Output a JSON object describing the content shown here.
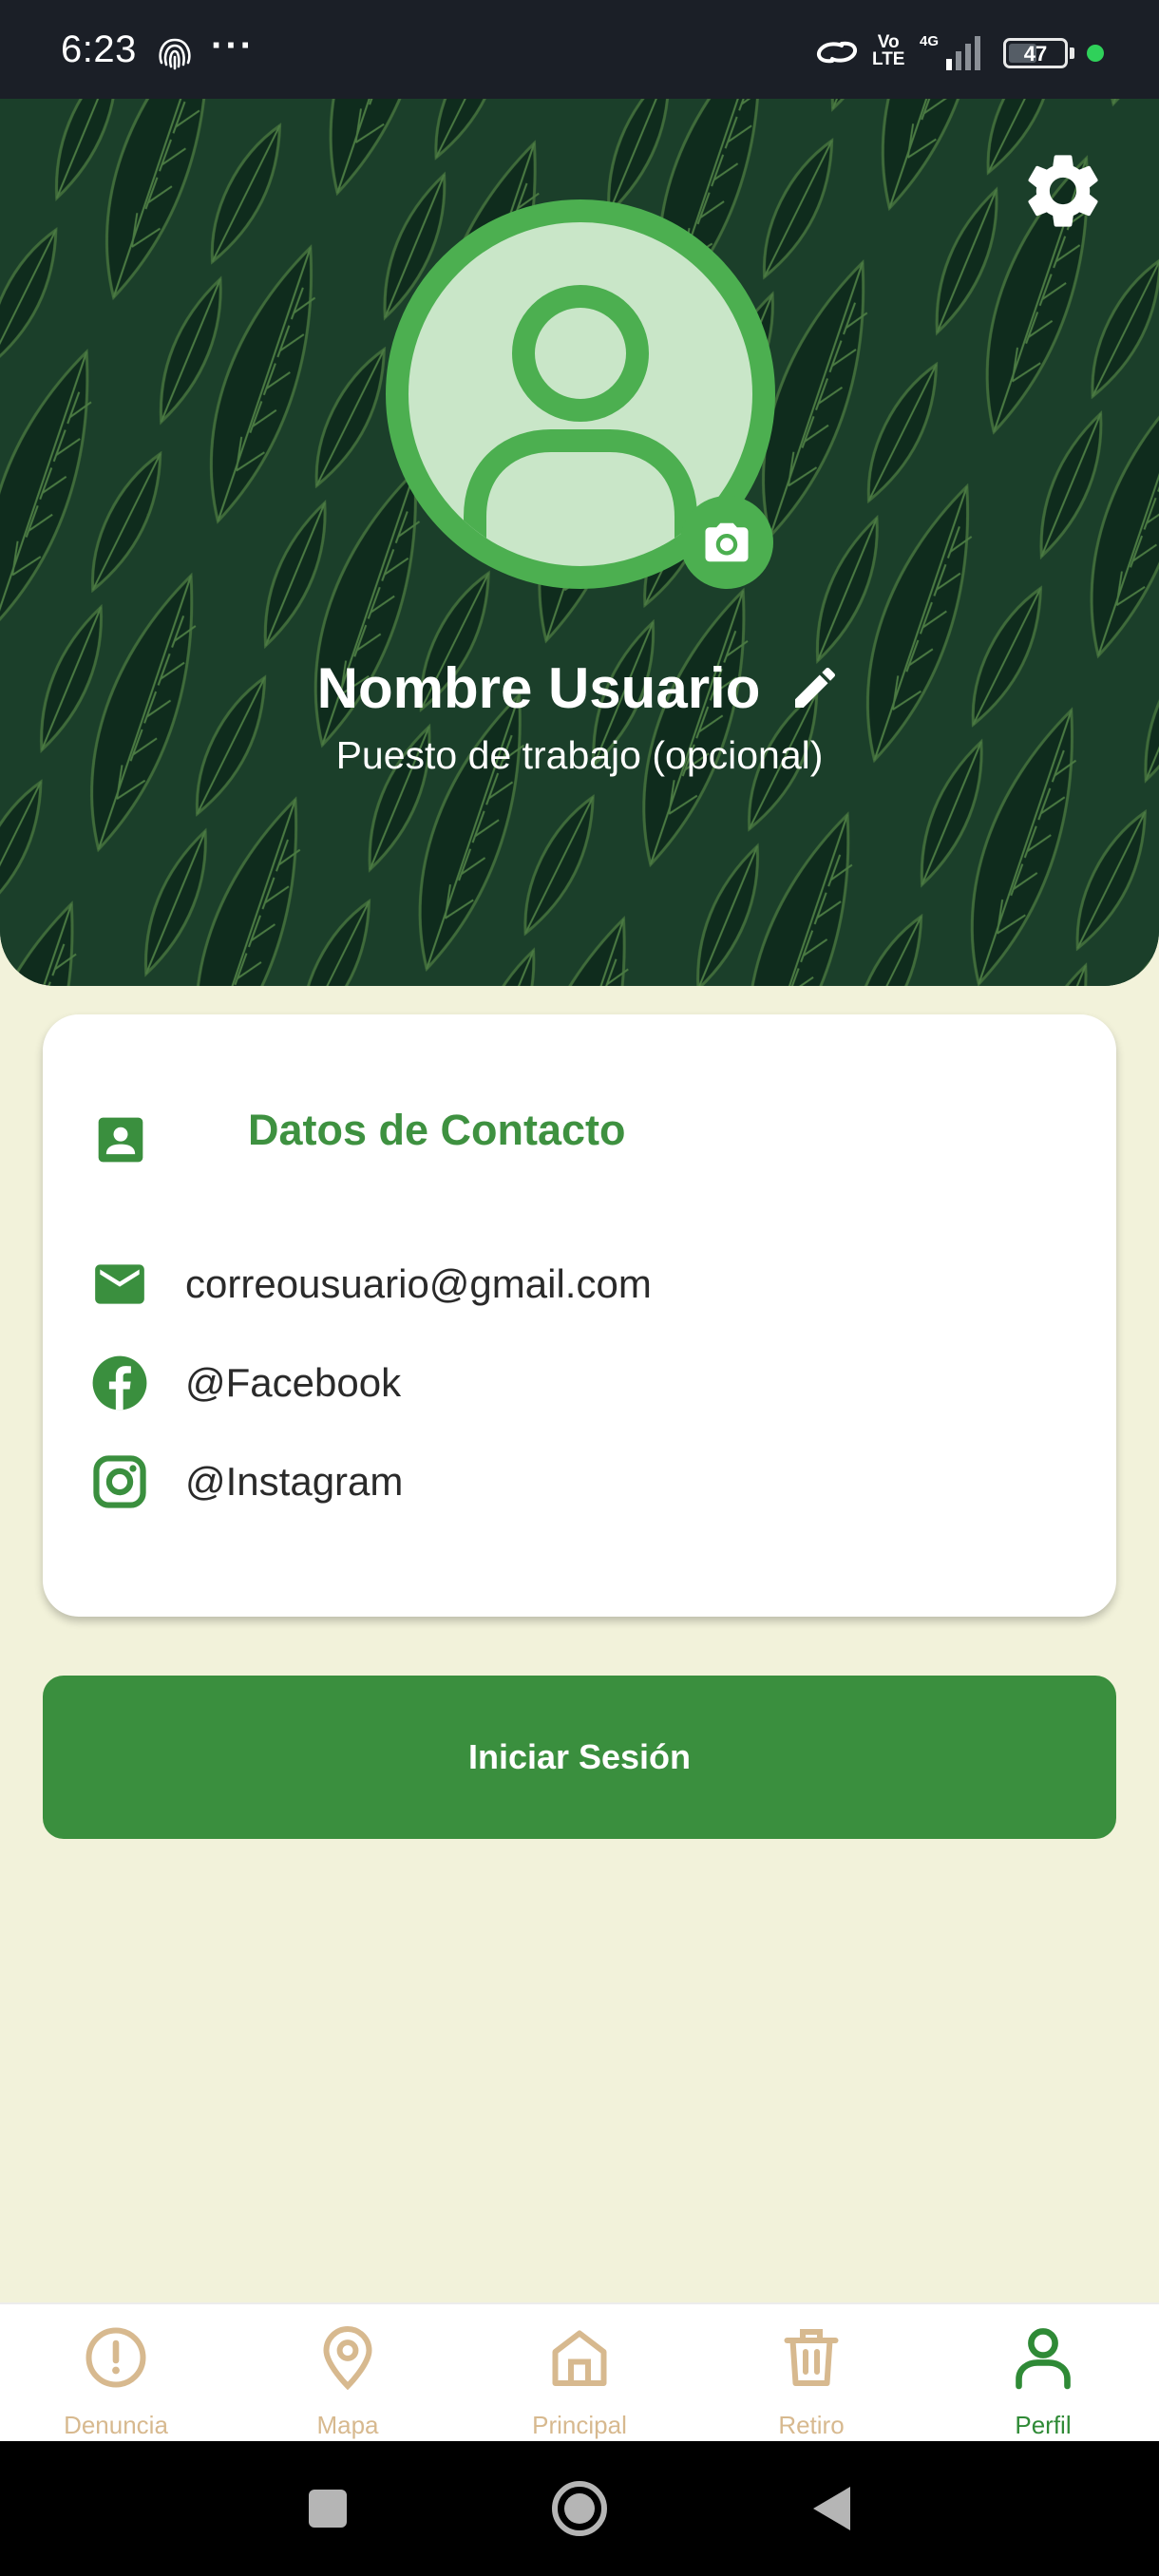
{
  "status_bar": {
    "time": "6:23",
    "dots": "···",
    "volte": "Vo\nLTE",
    "network": "4G",
    "battery": "47"
  },
  "header": {
    "user_name": "Nombre Usuario",
    "job_title": "Puesto de trabajo (opcional)",
    "icons": [
      "gear-icon",
      "avatar-placeholder-icon",
      "camera-icon",
      "pencil-icon"
    ]
  },
  "contact_card": {
    "title": "Datos de Contacto",
    "email": "correousuario@gmail.com",
    "facebook": "@Facebook",
    "instagram": "@Instagram"
  },
  "login_button": {
    "label": "Iniciar Sesión"
  },
  "bottom_nav": {
    "items": [
      {
        "label": "Denuncia",
        "icon": "alert-circle-icon",
        "active": false
      },
      {
        "label": "Mapa",
        "icon": "map-pin-icon",
        "active": false
      },
      {
        "label": "Principal",
        "icon": "home-icon",
        "active": false
      },
      {
        "label": "Retiro",
        "icon": "trash-icon",
        "active": false
      },
      {
        "label": "Perfil",
        "icon": "person-icon",
        "active": true
      }
    ]
  },
  "colors": {
    "accent": "#3a8f3e",
    "avatar_ring": "#4caf50",
    "background": "#f2f2da",
    "inactive_nav": "#d7b98f",
    "header_dark": "#173a26"
  }
}
